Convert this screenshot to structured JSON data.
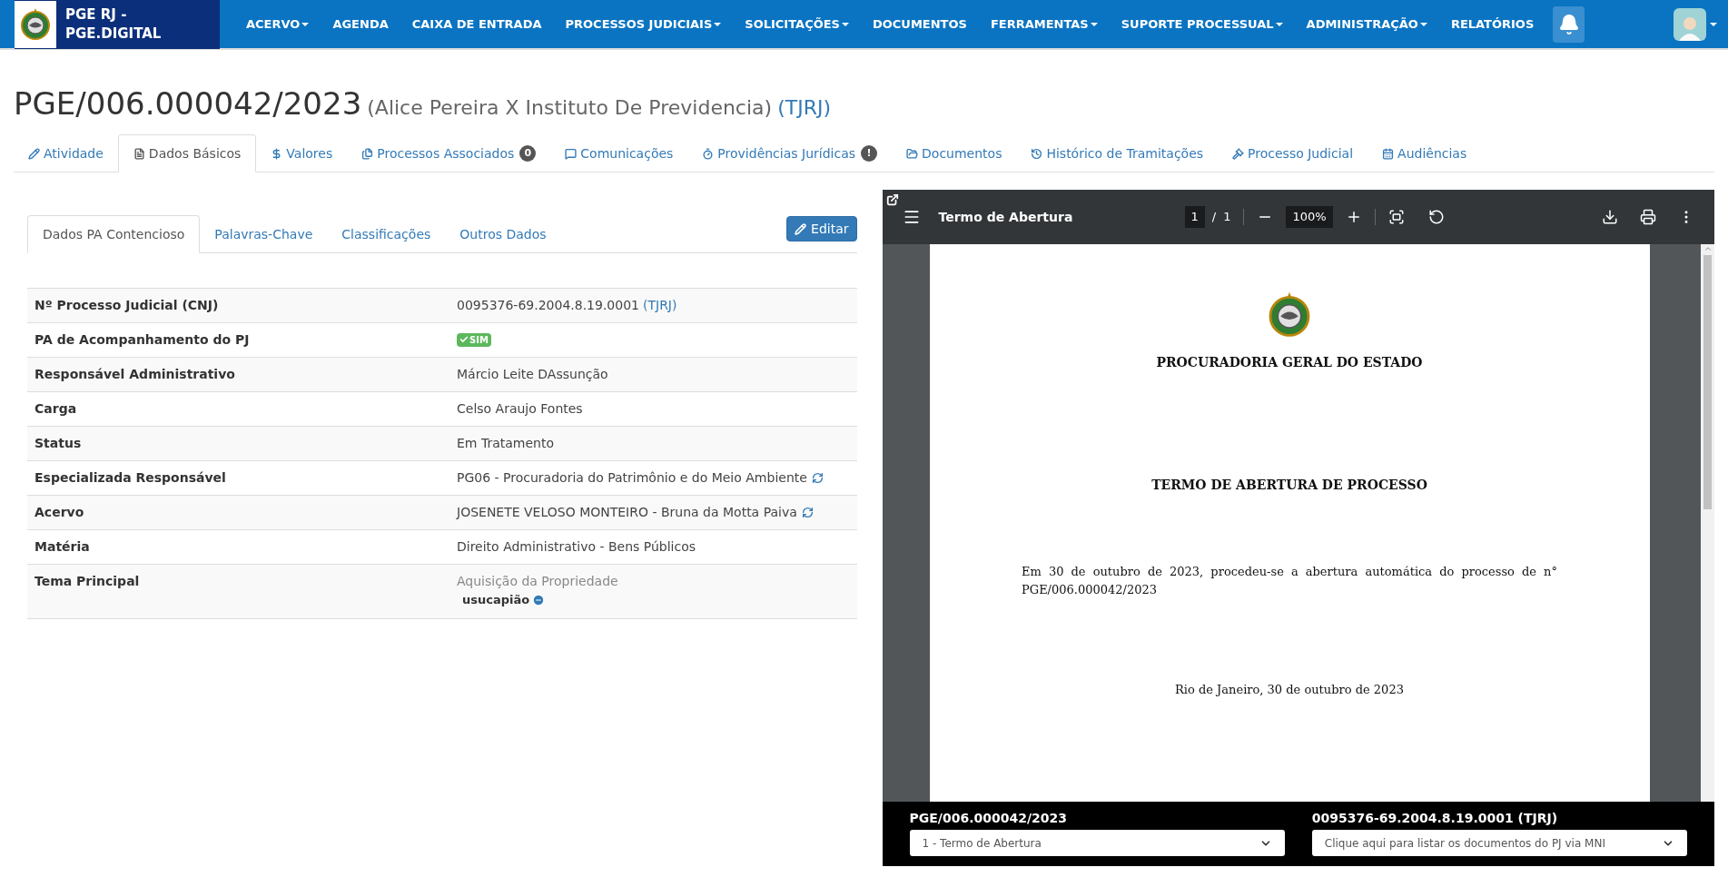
{
  "brand": {
    "line1": "PGE RJ -",
    "line2": "PGE.DIGITAL"
  },
  "nav": [
    {
      "label": "ACERVO",
      "dropdown": true
    },
    {
      "label": "AGENDA",
      "dropdown": false
    },
    {
      "label": "CAIXA DE ENTRADA",
      "dropdown": false
    },
    {
      "label": "PROCESSOS JUDICIAIS",
      "dropdown": true
    },
    {
      "label": "SOLICITAÇÕES",
      "dropdown": true
    },
    {
      "label": "DOCUMENTOS",
      "dropdown": false
    },
    {
      "label": "FERRAMENTAS",
      "dropdown": true
    },
    {
      "label": "SUPORTE PROCESSUAL",
      "dropdown": true
    },
    {
      "label": "ADMINISTRAÇÃO",
      "dropdown": true
    },
    {
      "label": "RELATÓRIOS",
      "dropdown": false
    }
  ],
  "page_title": {
    "number": "PGE/006.000042/2023",
    "parties": "(Alice Pereira X Instituto De Previdencia)",
    "court": "(TJRJ)"
  },
  "tabs": [
    {
      "label": "Atividade",
      "selected": false
    },
    {
      "label": "Dados Básicos",
      "selected": true
    },
    {
      "label": "Valores",
      "selected": false
    },
    {
      "label": "Processos Associados",
      "selected": false,
      "badge": "0"
    },
    {
      "label": "Comunicações",
      "selected": false
    },
    {
      "label": "Providências Jurídicas",
      "selected": false,
      "badge": "!"
    },
    {
      "label": "Documentos",
      "selected": false
    },
    {
      "label": "Histórico de Tramitações",
      "selected": false
    },
    {
      "label": "Processo Judicial",
      "selected": false
    },
    {
      "label": "Audiências",
      "selected": false
    }
  ],
  "subtabs": [
    {
      "label": "Dados PA Contencioso",
      "selected": true
    },
    {
      "label": "Palavras-Chave",
      "selected": false
    },
    {
      "label": "Classificações",
      "selected": false
    },
    {
      "label": "Outros Dados",
      "selected": false
    }
  ],
  "edit_button": "Editar",
  "rows": [
    {
      "label": "Nº Processo Judicial (CNJ)",
      "kind": "link",
      "value": "0095376-69.2004.8.19.0001",
      "link": "(TJRJ)"
    },
    {
      "label": "PA de Acompanhamento do PJ",
      "kind": "badge",
      "value": "SIM"
    },
    {
      "label": "Responsável Administrativo",
      "kind": "text",
      "value": "Márcio Leite DAssunção"
    },
    {
      "label": "Carga",
      "kind": "text",
      "value": "Celso Araujo Fontes"
    },
    {
      "label": "Status",
      "kind": "text",
      "value": "Em Tratamento"
    },
    {
      "label": "Especializada Responsável",
      "kind": "refresh",
      "value": "PG06 - Procuradoria do Patrimônio e do Meio Ambiente"
    },
    {
      "label": "Acervo",
      "kind": "refresh",
      "value": "JOSENETE VELOSO MONTEIRO - Bruna da Motta Paiva"
    },
    {
      "label": "Matéria",
      "kind": "text",
      "value": "Direito Administrativo - Bens Públicos"
    },
    {
      "label": "Tema Principal",
      "kind": "tema",
      "value": "Aquisição da Propriedade",
      "sub": "usucapião"
    }
  ],
  "pdf": {
    "title": "Termo de Abertura",
    "page": "1",
    "separator": "/",
    "pages": "1",
    "zoom": "100%",
    "heading": "PROCURADORIA GERAL DO ESTADO",
    "doc_title": "TERMO DE ABERTURA DE PROCESSO",
    "paragraph": "Em 30 de outubro de 2023, procedeu-se a abertura automática do processo de n° PGE/006.000042/2023",
    "date": "Rio de Janeiro, 30 de outubro de 2023"
  },
  "selectors": [
    {
      "label": "PGE/006.000042/2023",
      "value": "1 - Termo de Abertura"
    },
    {
      "label": "0095376-69.2004.8.19.0001 (TJRJ)",
      "value": "Clique aqui para listar os documentos do PJ via MNI"
    }
  ]
}
